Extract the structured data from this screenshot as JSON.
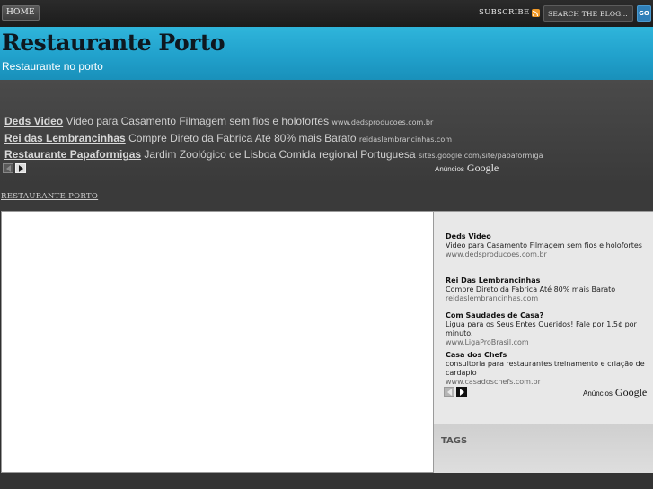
{
  "topbar": {
    "home_label": "HOME",
    "subscribe_label": "SUBSCRIBE",
    "rss_icon": "rss-icon",
    "search_placeholder": "SEARCH THE BLOG...",
    "go_label": "GO"
  },
  "header": {
    "title": "Restaurante Porto",
    "description": "Restaurante no porto"
  },
  "top_ads": {
    "items": [
      {
        "title": "Deds Video",
        "text": "Video para Casamento Filmagem sem fios e holofortes",
        "url": "www.dedsproducoes.com.br"
      },
      {
        "title": "Rei das Lembrancinhas",
        "text": "Compre Direto da Fabrica Até 80% mais Barato",
        "url": "reidaslembrancinhas.com"
      },
      {
        "title": "Restaurante Papaformigas",
        "text": "Jardim Zoológico de Lisboa Comida regional Portuguesa",
        "url": "sites.google.com/site/papaformiga"
      }
    ],
    "ads_by_label": "Anúncios",
    "google_label": "Google"
  },
  "breadcrumb": "RESTAURANTE PORTO",
  "sidebar": {
    "ads": [
      {
        "title": "Deds Video",
        "text": "Video para Casamento Filmagem sem fios e holofortes",
        "url": "www.dedsproducoes.com.br"
      },
      {
        "title": "Rei Das Lembrancinhas",
        "text": "Compre Direto da Fabrica Até 80% mais Barato",
        "url": "reidaslembrancinhas.com"
      },
      {
        "title": "Com Saudades de Casa?",
        "text": "Ligua para os Seus Entes Queridos! Fale por 1.5¢ por minuto.",
        "url": "www.LigaProBrasil.com"
      },
      {
        "title": "Casa dos Chefs",
        "text": "consultoria para restaurantes treinamento e criação de cardapio",
        "url": "www.casadoschefs.com.br"
      }
    ],
    "ads_by_label": "Anúncios",
    "google_label": "Google",
    "tags_title": "TAGS"
  }
}
